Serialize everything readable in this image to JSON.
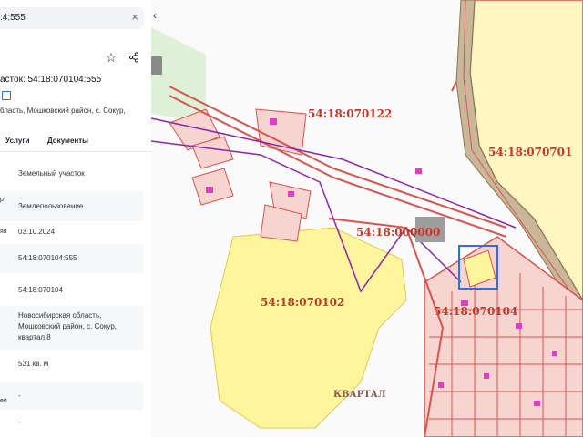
{
  "panel": {
    "search_value": ":4:555",
    "title": "асток: 54:18:070104:555",
    "address_short": "бласть, Мошковский район, с. Сокур,",
    "tabs": [
      "Услуги",
      "Документы"
    ],
    "rows": [
      {
        "label": "",
        "value": "Земельный участок"
      },
      {
        "label": "р",
        "value": "Землепользование"
      },
      {
        "label": "яя",
        "value": "03.10.2024"
      },
      {
        "label": "",
        "value": "54:18:070104:555"
      },
      {
        "label": "",
        "value": "54:18:070104"
      },
      {
        "label": "",
        "value": "Новосибирская область, Мошковский район, с. Сокур, квартал 8"
      },
      {
        "label": "",
        "value": "531 кв. м"
      },
      {
        "label": "ея",
        "value": "-"
      },
      {
        "label": "",
        "value": "-"
      }
    ]
  },
  "map": {
    "labels": [
      {
        "text": "54:18:070122"
      },
      {
        "text": "54:18:070701"
      },
      {
        "text": "54:18:000000"
      },
      {
        "text": "54:18:070102"
      },
      {
        "text": "54:18:070104"
      },
      {
        "text": "КВАРТАЛ"
      }
    ]
  },
  "colors": {
    "parcel_border": "#d9534f",
    "parcel_fill": "#f6d5d0",
    "highlight_fill": "#fff59d",
    "boundary_line": "#8e24aa",
    "selection": "#2f6fe5",
    "road_band": "#c9b79a"
  }
}
